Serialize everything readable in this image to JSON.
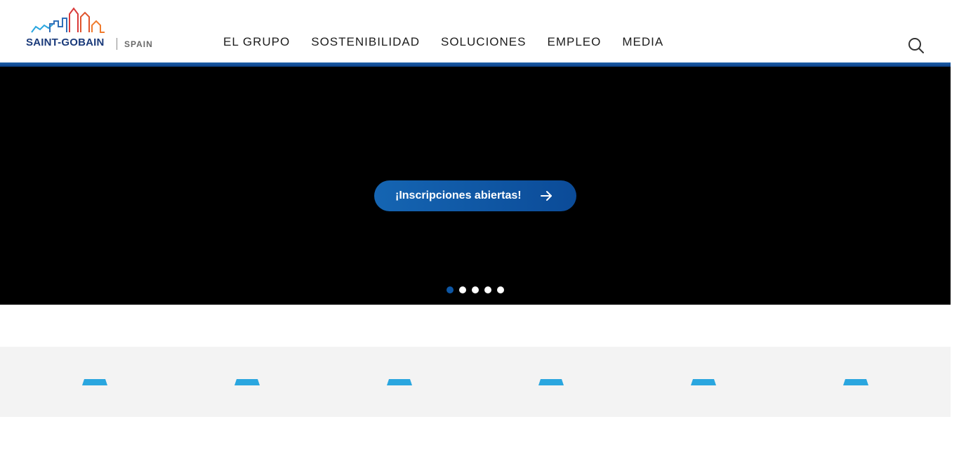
{
  "logo": {
    "wordmark": "SAINT-GOBAIN",
    "country": "SPAIN"
  },
  "nav": {
    "items": [
      {
        "label": "EL GRUPO"
      },
      {
        "label": "SOSTENIBILIDAD"
      },
      {
        "label": "SOLUCIONES"
      },
      {
        "label": "EMPLEO"
      },
      {
        "label": "MEDIA"
      }
    ]
  },
  "search": {
    "icon": "search-icon"
  },
  "hero": {
    "cta_label": "¡Inscripciones abiertas!",
    "cta_icon": "arrow-right-icon",
    "slides": {
      "count": 5,
      "active": 1
    }
  },
  "band": {
    "item_count": 6,
    "icon": "placeholder-tab-icon"
  },
  "colors": {
    "brand_blue": "#0d56a4",
    "accent_light_blue": "#2aa6df",
    "hero_background": "#000000",
    "band_background": "#f3f3f3",
    "nav_text": "#1c1c1c"
  }
}
